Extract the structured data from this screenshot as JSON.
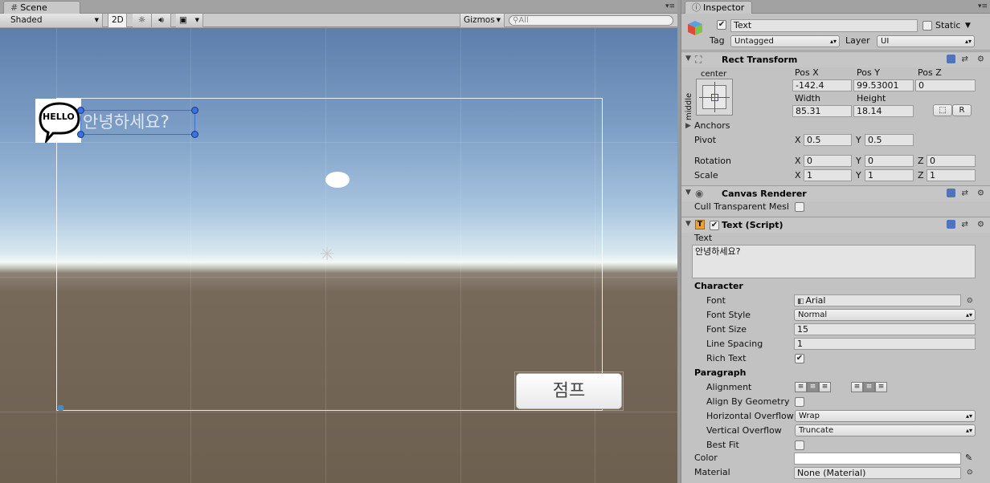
{
  "scene": {
    "tab_label": "Scene",
    "shading_mode": "Shaded",
    "toggle_2d": "2D",
    "gizmos_label": "Gizmos",
    "search_placeholder": "All",
    "text_label": "안녕하세요?",
    "button_label": "점프",
    "hello_image_text": "HELLO"
  },
  "inspector": {
    "tab_label": "Inspector",
    "object_name": "Text",
    "static_label": "Static",
    "tag_label": "Tag",
    "tag_value": "Untagged",
    "layer_label": "Layer",
    "layer_value": "UI",
    "rect_transform": {
      "title": "Rect Transform",
      "anchor_h": "center",
      "anchor_v": "middle",
      "pos_x_label": "Pos X",
      "pos_y_label": "Pos Y",
      "pos_z_label": "Pos Z",
      "pos_x": "-142.4",
      "pos_y": "99.53001",
      "pos_z": "0",
      "width_label": "Width",
      "height_label": "Height",
      "width": "85.31",
      "height": "18.14",
      "r_button": "R",
      "anchors_label": "Anchors",
      "pivot_label": "Pivot",
      "pivot_x": "0.5",
      "pivot_y": "0.5",
      "rotation_label": "Rotation",
      "rot_x": "0",
      "rot_y": "0",
      "rot_z": "0",
      "scale_label": "Scale",
      "scale_x": "1",
      "scale_y": "1",
      "scale_z": "1",
      "axis_x": "X",
      "axis_y": "Y",
      "axis_z": "Z"
    },
    "canvas_renderer": {
      "title": "Canvas Renderer",
      "cull_label": "Cull Transparent Mesl"
    },
    "text_script": {
      "title": "Text (Script)",
      "text_label": "Text",
      "text_value": "안녕하세요?",
      "character_label": "Character",
      "font_label": "Font",
      "font_value": "Arial",
      "font_style_label": "Font Style",
      "font_style_value": "Normal",
      "font_size_label": "Font Size",
      "font_size_value": "15",
      "line_spacing_label": "Line Spacing",
      "line_spacing_value": "1",
      "rich_text_label": "Rich Text",
      "paragraph_label": "Paragraph",
      "alignment_label": "Alignment",
      "align_geometry_label": "Align By Geometry",
      "h_overflow_label": "Horizontal Overflow",
      "h_overflow_value": "Wrap",
      "v_overflow_label": "Vertical Overflow",
      "v_overflow_value": "Truncate",
      "best_fit_label": "Best Fit",
      "color_label": "Color",
      "material_label": "Material",
      "material_value": "None (Material)"
    }
  }
}
